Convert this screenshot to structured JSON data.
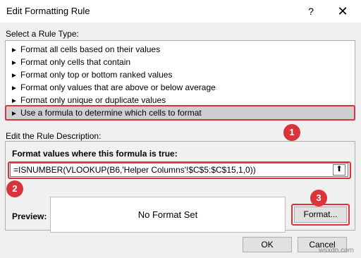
{
  "window": {
    "title": "Edit Formatting Rule",
    "help": "?",
    "close": "✕"
  },
  "rule_type": {
    "label": "Select a Rule Type:",
    "items": [
      {
        "label": "Format all cells based on their values"
      },
      {
        "label": "Format only cells that contain"
      },
      {
        "label": "Format only top or bottom ranked values"
      },
      {
        "label": "Format only values that are above or below average"
      },
      {
        "label": "Format only unique or duplicate values"
      },
      {
        "label": "Use a formula to determine which cells to format"
      }
    ],
    "selected_index": 5,
    "arrow": "►"
  },
  "description": {
    "label": "Edit the Rule Description:",
    "formula_label": "Format values where this formula is true:",
    "formula_value": "=ISNUMBER(VLOOKUP(B6,'Helper Columns'!$C$5:$C$15,1,0))",
    "collapse_icon": "⬆"
  },
  "preview": {
    "label": "Preview:",
    "text": "No Format Set"
  },
  "buttons": {
    "format": "Format...",
    "ok": "OK",
    "cancel": "Cancel"
  },
  "annotations": {
    "badge1": "1",
    "badge2": "2",
    "badge3": "3",
    "accent_color": "#d9343c"
  },
  "watermark": "wsxdn.com"
}
